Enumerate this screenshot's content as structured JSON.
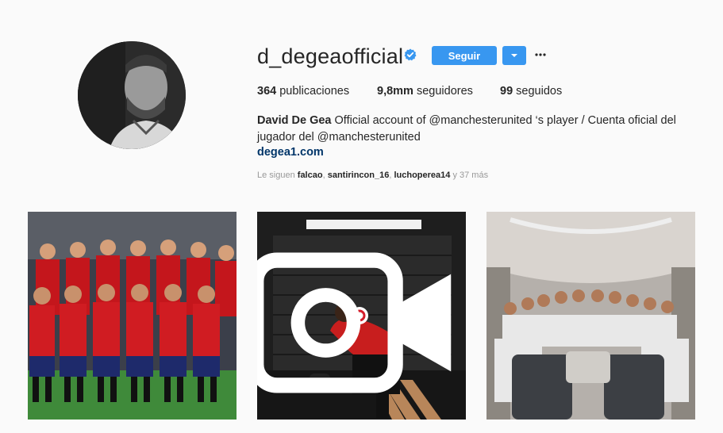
{
  "profile": {
    "username": "d_degeaofficial",
    "verified": true,
    "follow_label": "Seguir",
    "stats": {
      "posts_count": "364",
      "posts_label": "publicaciones",
      "followers_count": "9,8mm",
      "followers_label": "seguidores",
      "following_count": "99",
      "following_label": "seguidos"
    },
    "bio": {
      "full_name": "David De Gea",
      "text_line": "Official account of @manchesterunited ‘s player / Cuenta oficial del jugador del @manchesterunited",
      "link": "degea1.com"
    },
    "followed_by": {
      "prefix": "Le siguen",
      "users": [
        "falcao",
        "santirincon_16",
        "luchoperea14"
      ],
      "suffix": "y 37 más"
    }
  },
  "posts": [
    {
      "kind": "photo",
      "icon": "none"
    },
    {
      "kind": "video",
      "icon": "video-camera-icon"
    },
    {
      "kind": "photo",
      "icon": "none"
    }
  ],
  "colors": {
    "accent": "#3897f0",
    "link": "#003569",
    "verified": "#3897f0",
    "background": "#fafafa"
  }
}
